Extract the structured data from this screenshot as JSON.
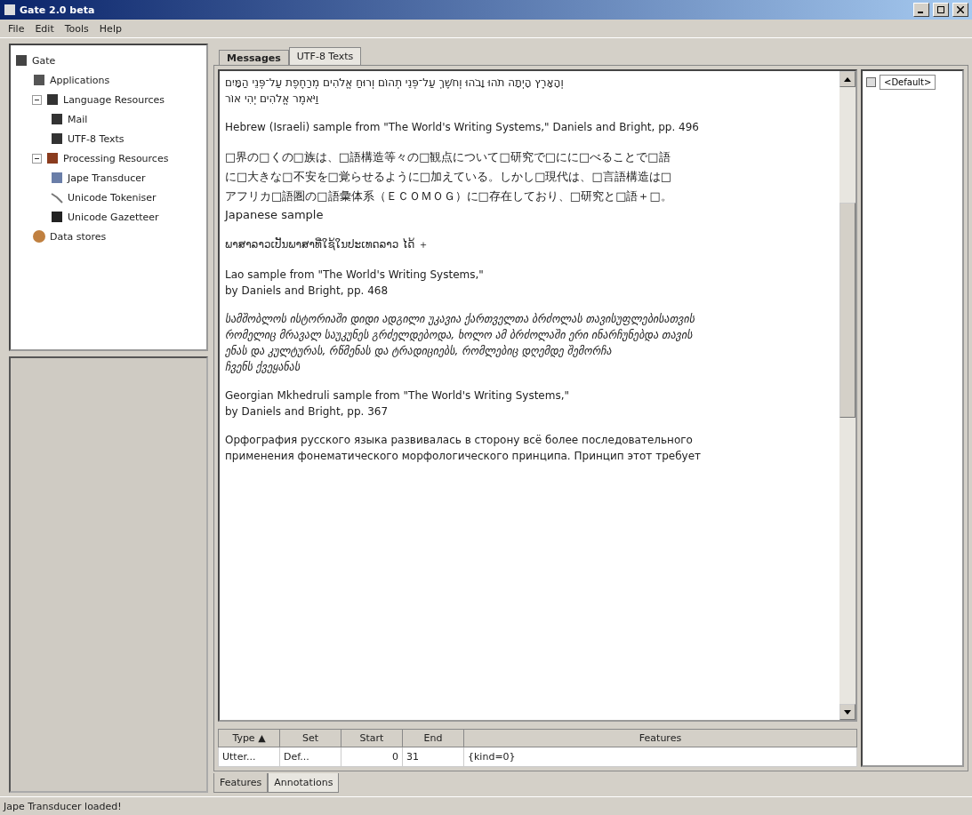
{
  "window": {
    "title": "Gate 2.0 beta"
  },
  "menu": [
    "File",
    "Edit",
    "Tools",
    "Help"
  ],
  "tree": {
    "label": "Gate",
    "kind": "gate",
    "children": [
      {
        "label": "Applications",
        "kind": "apps"
      },
      {
        "label": "Language Resources",
        "kind": "doc",
        "expanded": true,
        "children": [
          {
            "label": "Mail",
            "kind": "doc"
          },
          {
            "label": "UTF-8 Texts",
            "kind": "doc"
          }
        ]
      },
      {
        "label": "Processing Resources",
        "kind": "proc",
        "expanded": true,
        "children": [
          {
            "label": "Jape Transducer",
            "kind": "jape"
          },
          {
            "label": "Unicode Tokeniser",
            "kind": "tok"
          },
          {
            "label": "Unicode Gazetteer",
            "kind": "gaz"
          }
        ]
      },
      {
        "label": "Data stores",
        "kind": "ds"
      }
    ]
  },
  "tabs": [
    {
      "label": "Messages",
      "selected": false
    },
    {
      "label": "UTF-8 Texts",
      "selected": true
    }
  ],
  "paragraphs": [
    {
      "kind": "rtl",
      "lines": [
        "וְהָאָרֶץ הָיְתָה תֹהוּ וָבֹהוּ וְחֹשֶׁךְ עַל־פְּנֵי תְהוֹם וְרוּחַ אֱלֹהִים מְרַחֶפֶת עַל־פְּנֵי הַמָּיִם",
        "וַיֹּאמֶר אֱלֹהִים יְהִי אוֹר"
      ]
    },
    {
      "kind": "plain",
      "lines": [
        "Hebrew (Israeli) sample from \"The World's Writing Systems,\" Daniels and Bright, pp. 496"
      ]
    },
    {
      "kind": "cjk",
      "lines": [
        "□界の□くの□族は、□語構造等々の□観点について□研究で□にに□べることで□語",
        "に□大きな□不安を□覚らせるように□加えている。しかし□現代は、□言語構造は□",
        "アフリカ□語圏の□語彙体系（ＥＣＯＭＯＧ）に□存在しており、□研究と□語＋□。",
        "Japanese sample"
      ]
    },
    {
      "kind": "plain",
      "lines": [
        "ພາສາລາວເປັນພາສາທີ່ໃຊ້ໃນປະເທດລາວ ໄດ້ ＋"
      ]
    },
    {
      "kind": "plain",
      "lines": [
        "Lao sample from \"The World's Writing Systems,\"",
        "by Daniels and Bright, pp. 468"
      ]
    },
    {
      "kind": "italic",
      "lines": [
        "სამშობლოს ისტორიაში დიდი ადგილი უკავია ქართველთა ბრძოლას თავისუფლებისათვის",
        "რომელიც მრავალ საუკუნეს გრძელდებოდა, ხოლო ამ ბრძოლაში ერი ინარჩუნებდა თავის",
        "ენას და კულტურას, რწმენას და ტრადიციებს, რომლებიც დღემდე შემორჩა",
        "ჩვენს ქვეყანას"
      ]
    },
    {
      "kind": "plain",
      "lines": [
        "Georgian Mkhedruli sample from \"The World's Writing Systems,\"",
        "by Daniels and Bright, pp. 367"
      ]
    },
    {
      "kind": "plain",
      "lines": [
        "Орфография русского языка развивалась в сторону всё более последовательного",
        "применения фонематического морфологического принципа. Принцип этот требует"
      ]
    }
  ],
  "annotation_sets": [
    {
      "label": "<Default>",
      "checked": false
    }
  ],
  "table": {
    "columns": [
      "Type ▲",
      "Set",
      "Start",
      "End",
      "Features"
    ],
    "rows": [
      [
        "Utter...",
        "Def...",
        "0",
        "31",
        "{kind=0}"
      ]
    ]
  },
  "bottom_tabs": [
    {
      "label": "Features",
      "selected": false
    },
    {
      "label": "Annotations",
      "selected": true
    }
  ],
  "status": "Jape Transducer loaded!"
}
